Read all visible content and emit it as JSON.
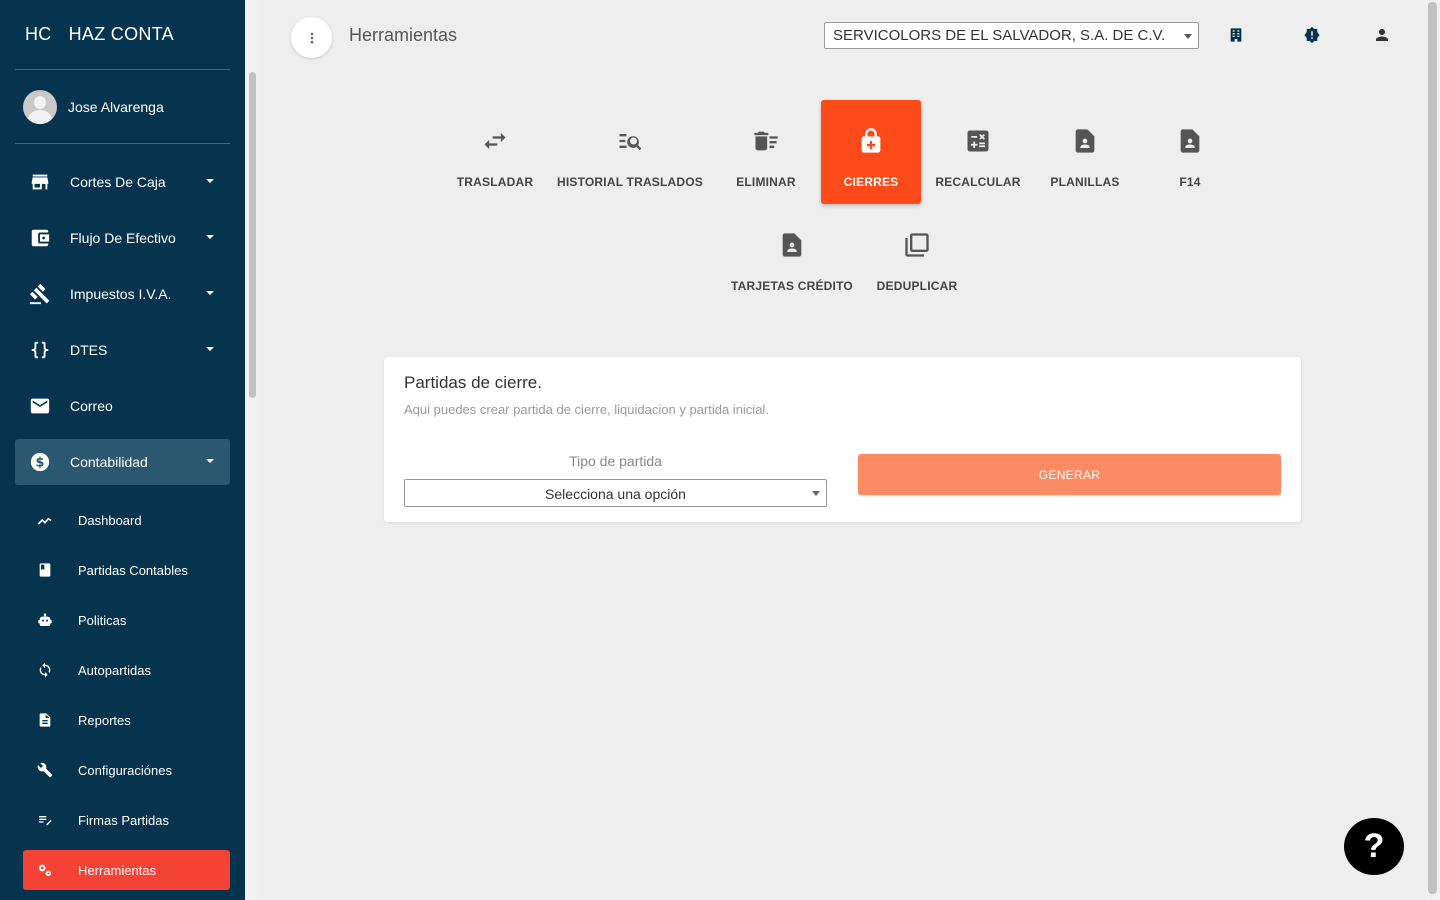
{
  "app": {
    "brand_short": "HC",
    "brand_name": "HAZ CONTA"
  },
  "user": {
    "name": "Jose Alvarenga"
  },
  "sidebar": {
    "items": [
      {
        "label": "Cortes De Caja",
        "icon": "store-icon"
      },
      {
        "label": "Flujo De Efectivo",
        "icon": "wallet-icon"
      },
      {
        "label": "Impuestos I.V.A.",
        "icon": "gavel-icon"
      },
      {
        "label": "DTES",
        "icon": "braces-icon"
      },
      {
        "label": "Correo",
        "icon": "mail-icon"
      },
      {
        "label": "Contabilidad",
        "icon": "dollar-icon"
      }
    ],
    "subitems": [
      {
        "label": "Dashboard",
        "icon": "trending-icon"
      },
      {
        "label": "Partidas Contables",
        "icon": "book-icon"
      },
      {
        "label": "Politicas",
        "icon": "robot-icon"
      },
      {
        "label": "Autopartidas",
        "icon": "sync-icon"
      },
      {
        "label": "Reportes",
        "icon": "document-icon"
      },
      {
        "label": "Configuraciónes",
        "icon": "wrench-icon"
      },
      {
        "label": "Firmas Partidas",
        "icon": "edit-list-icon"
      },
      {
        "label": "Herramientas",
        "icon": "gears-icon"
      }
    ]
  },
  "header": {
    "title": "Herramientas",
    "company": "SERVICOLORS DE EL SALVADOR, S.A. DE C.V."
  },
  "tools": [
    {
      "label": "TRASLADAR",
      "icon": "swap-icon"
    },
    {
      "label": "HISTORIAL TRASLADOS",
      "icon": "search-list-icon"
    },
    {
      "label": "ELIMINAR",
      "icon": "delete-sweep-icon"
    },
    {
      "label": "CIERRES",
      "icon": "lock-icon"
    },
    {
      "label": "RECALCULAR",
      "icon": "calculator-icon"
    },
    {
      "label": "PLANILLAS",
      "icon": "person-document-icon"
    },
    {
      "label": "F14",
      "icon": "person-document-icon"
    },
    {
      "label": "TARJETAS CRÉDITO",
      "icon": "person-document-icon"
    },
    {
      "label": "DEDUPLICAR",
      "icon": "copy-icon"
    }
  ],
  "card": {
    "title": "Partidas de cierre.",
    "subtitle": "Aqui puedes crear partida de cierre, liquidacion y partida inicial.",
    "field_label": "Tipo de partida",
    "select_value": "Selecciona una opción",
    "button_label": "GENERAR"
  },
  "help": {
    "label": "?"
  },
  "colors": {
    "sidebar": "#06344f",
    "accent": "#fc4a1a",
    "active_sub": "#f44336",
    "button": "#fc8a63"
  }
}
